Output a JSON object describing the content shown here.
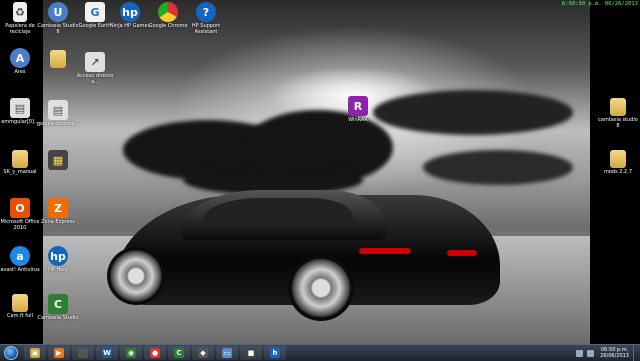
{
  "clock_overlay": "6:50:30 p.m. 06/26/2013",
  "desktop_icons": [
    {
      "id": "recycle",
      "label": "Papelera de reciclaje",
      "glyph": "♻",
      "icon": "recycle-bin-icon",
      "cls": "recycle"
    },
    {
      "id": "user",
      "label": "Ares",
      "glyph": "A",
      "icon": "user-icon",
      "cls": "user"
    },
    {
      "id": "emmgular",
      "label": "emmgular[0]...",
      "glyph": "▤",
      "icon": "document-icon",
      "cls": "doc"
    },
    {
      "id": "sk-manual",
      "label": "SK_y_manual",
      "glyph": "",
      "icon": "folder-icon",
      "cls": "folder"
    },
    {
      "id": "office",
      "label": "Microsoft Office 2010",
      "glyph": "O",
      "icon": "office-icon",
      "cls": "office"
    },
    {
      "id": "avast",
      "label": "avast! Antivirus",
      "glyph": "a",
      "icon": "avast-icon",
      "cls": "avast"
    },
    {
      "id": "camfull",
      "label": "Cam.ft full",
      "glyph": "",
      "icon": "folder-icon",
      "cls": "folder"
    },
    {
      "id": "c2-1",
      "label": "Camtasia Studio 8",
      "glyph": "U",
      "icon": "user-icon",
      "cls": "user"
    },
    {
      "id": "c2-2",
      "label": "",
      "glyph": "",
      "icon": "folder-icon",
      "cls": "folder"
    },
    {
      "id": "c2-3",
      "label": "google-chrome...",
      "glyph": "▤",
      "icon": "document-icon",
      "cls": "doc"
    },
    {
      "id": "c2-4",
      "label": "",
      "glyph": "▦",
      "icon": "star-icon",
      "cls": "star"
    },
    {
      "id": "c2-5",
      "label": "Zona Express",
      "glyph": "Z",
      "icon": "app-icon",
      "cls": "orange"
    },
    {
      "id": "c2-6",
      "label": "HP Help",
      "glyph": "hp",
      "icon": "hp-icon",
      "cls": "hp"
    },
    {
      "id": "c2-7",
      "label": "Camtasia Studio",
      "glyph": "C",
      "icon": "camtasia-icon",
      "cls": "camtasia"
    },
    {
      "id": "google",
      "label": "Google Earth",
      "glyph": "G",
      "icon": "google-icon",
      "cls": "google"
    },
    {
      "id": "hpinfo",
      "label": "Ninja HP Games",
      "glyph": "hp",
      "icon": "hp-icon",
      "cls": "hp"
    },
    {
      "id": "chrome",
      "label": "Google Chrome",
      "glyph": "",
      "icon": "chrome-icon",
      "cls": "chrome"
    },
    {
      "id": "hpsupport",
      "label": "HP Support Assistant",
      "glyph": "?",
      "icon": "hp-support-icon",
      "cls": "hp"
    },
    {
      "id": "shortcut",
      "label": "Acceso directo a...",
      "glyph": "↗",
      "icon": "shortcut-icon",
      "cls": "doc"
    },
    {
      "id": "winrar",
      "label": "WinRAR",
      "glyph": "R",
      "icon": "winrar-icon",
      "cls": "winrar"
    },
    {
      "id": "camtasia8",
      "label": "camtasia studio 8",
      "glyph": "",
      "icon": "folder-icon",
      "cls": "folder"
    },
    {
      "id": "mods",
      "label": "mods 2.2.7",
      "glyph": "",
      "icon": "folder-icon",
      "cls": "folder"
    }
  ],
  "taskbar": {
    "pinned": [
      {
        "icon": "explorer-icon",
        "glyph": "▣",
        "color": "#c9a24a"
      },
      {
        "icon": "media-player-icon",
        "glyph": "▶",
        "color": "#e07a1c"
      },
      {
        "icon": "blank-app-icon",
        "glyph": "",
        "color": "#555"
      },
      {
        "icon": "word-icon",
        "glyph": "W",
        "color": "#2b5797"
      },
      {
        "icon": "screen-recorder-icon",
        "glyph": "◉",
        "color": "#2e7d32"
      },
      {
        "icon": "chrome-icon",
        "glyph": "●",
        "color": "#d33"
      },
      {
        "icon": "camtasia-icon",
        "glyph": "C",
        "color": "#2e7d32"
      },
      {
        "icon": "gamepad-icon",
        "glyph": "◆",
        "color": "#555"
      },
      {
        "icon": "window-icon",
        "glyph": "▭",
        "color": "#5b8cc4"
      },
      {
        "icon": "app-icon",
        "glyph": "■",
        "color": "#444"
      },
      {
        "icon": "hp-icon",
        "glyph": "h",
        "color": "#1565c0"
      }
    ],
    "tray_time": "06:50 p.m.",
    "tray_date": "26/06/2013"
  }
}
